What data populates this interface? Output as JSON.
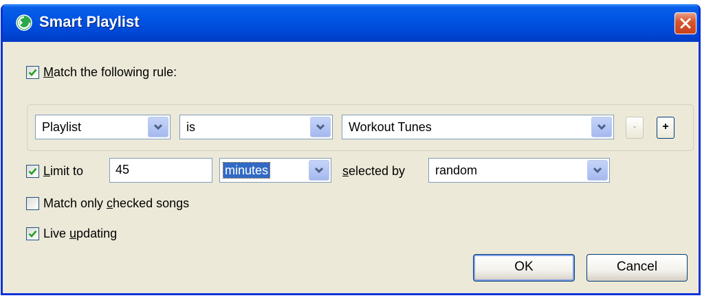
{
  "window": {
    "title": "Smart Playlist"
  },
  "match_rule": {
    "label": "Match the following rule:",
    "underline_char": "M",
    "rest": "atch the following rule:",
    "checked": true
  },
  "rule": {
    "field": "Playlist",
    "operator": "is",
    "value": "Workout Tunes",
    "remove_label": "-",
    "add_label": "+"
  },
  "limit": {
    "checked": true,
    "label_u": "L",
    "label_rest": "imit to",
    "amount": "45",
    "unit": "minutes",
    "selected_by_u": "s",
    "selected_by_rest": "elected by",
    "method": "random"
  },
  "match_checked": {
    "checked": false,
    "pre": "Match only ",
    "u": "c",
    "post": "hecked songs"
  },
  "live_updating": {
    "checked": true,
    "pre": "Live ",
    "u": "u",
    "post": "pdating"
  },
  "buttons": {
    "ok": "OK",
    "cancel": "Cancel"
  },
  "colors": {
    "titlebar": "#0054e3",
    "dialog_bg": "#ece9d8",
    "close": "#c8401b",
    "selection": "#316ac5"
  }
}
